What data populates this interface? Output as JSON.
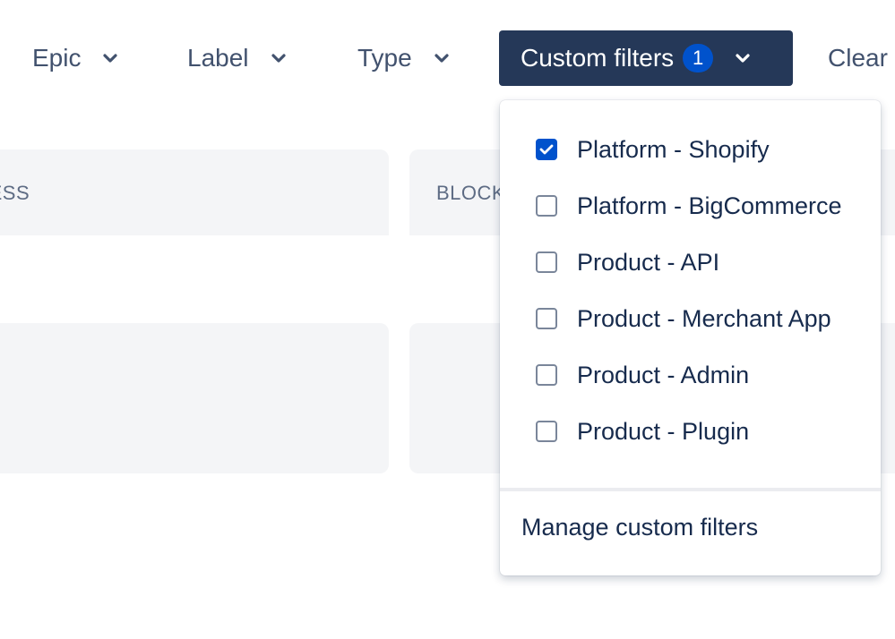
{
  "toolbar": {
    "epic_label": "Epic",
    "label_label": "Label",
    "type_label": "Type",
    "custom_filters_label": "Custom filters",
    "custom_filters_count": "1",
    "clear_label": "Clear"
  },
  "board": {
    "columns": [
      {
        "title": "OGRESS"
      },
      {
        "title": "BLOCK"
      }
    ]
  },
  "dropdown": {
    "items": [
      {
        "label": "Platform - Shopify",
        "checked": true
      },
      {
        "label": "Platform - BigCommerce",
        "checked": false
      },
      {
        "label": "Product - API",
        "checked": false
      },
      {
        "label": "Product - Merchant App",
        "checked": false
      },
      {
        "label": "Product - Admin",
        "checked": false
      },
      {
        "label": "Product - Plugin",
        "checked": false
      }
    ],
    "footer_label": "Manage custom filters"
  },
  "colors": {
    "toolbar_active_bg": "#253858",
    "badge_bg": "#0052cc",
    "checkbox_checked": "#0052cc",
    "column_bg": "#f4f5f7",
    "text_primary": "#172b4d",
    "text_secondary": "#42526e"
  },
  "icons": {
    "dropdown_chevron": "chevron-down-icon",
    "checkbox_check": "check-icon"
  }
}
